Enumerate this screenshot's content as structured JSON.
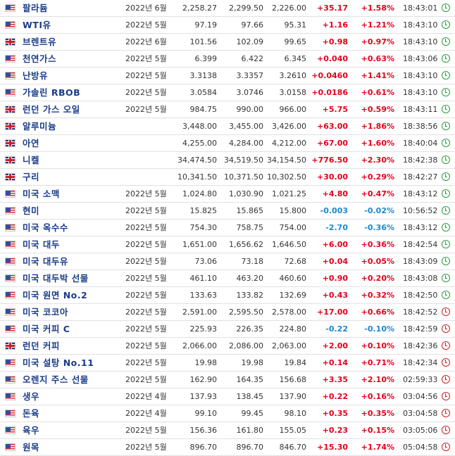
{
  "colors": {
    "up": "#e3001b",
    "down": "#1a87d2",
    "name": "#1a3c8a",
    "open_clock": "#22a036",
    "closed_clock": "#d21c1c"
  },
  "rows": [
    {
      "flag": "us",
      "name": "팔라듐",
      "month": "2022년 6월",
      "last": "2,258.27",
      "high": "2,299.50",
      "low": "2,226.00",
      "chg": "+35.17",
      "pct": "+1.58%",
      "time": "18:43:01",
      "dir": "up",
      "status": "open"
    },
    {
      "flag": "us",
      "name": "WTI유",
      "month": "2022년 5월",
      "last": "97.19",
      "high": "97.66",
      "low": "95.31",
      "chg": "+1.16",
      "pct": "+1.21%",
      "time": "18:43:10",
      "dir": "up",
      "status": "open"
    },
    {
      "flag": "uk",
      "name": "브렌트유",
      "month": "2022년 6월",
      "last": "101.56",
      "high": "102.09",
      "low": "99.65",
      "chg": "+0.98",
      "pct": "+0.97%",
      "time": "18:43:10",
      "dir": "up",
      "status": "open"
    },
    {
      "flag": "us",
      "name": "천연가스",
      "month": "2022년 5월",
      "last": "6.399",
      "high": "6.422",
      "low": "6.345",
      "chg": "+0.040",
      "pct": "+0.63%",
      "time": "18:43:06",
      "dir": "up",
      "status": "open"
    },
    {
      "flag": "us",
      "name": "난방유",
      "month": "2022년 5월",
      "last": "3.3138",
      "high": "3.3357",
      "low": "3.2610",
      "chg": "+0.0460",
      "pct": "+1.41%",
      "time": "18:43:10",
      "dir": "up",
      "status": "open"
    },
    {
      "flag": "us",
      "name": "가솔린 RBOB",
      "month": "2022년 5월",
      "last": "3.0584",
      "high": "3.0746",
      "low": "3.0158",
      "chg": "+0.0186",
      "pct": "+0.61%",
      "time": "18:43:10",
      "dir": "up",
      "status": "open"
    },
    {
      "flag": "uk",
      "name": "런던 가스 오일",
      "month": "2022년 5월",
      "last": "984.75",
      "high": "990.00",
      "low": "966.00",
      "chg": "+5.75",
      "pct": "+0.59%",
      "time": "18:43:11",
      "dir": "up",
      "status": "open"
    },
    {
      "flag": "uk",
      "name": "알루미늄",
      "month": "",
      "last": "3,448.00",
      "high": "3,455.00",
      "low": "3,426.00",
      "chg": "+63.00",
      "pct": "+1.86%",
      "time": "18:38:56",
      "dir": "up",
      "status": "open"
    },
    {
      "flag": "uk",
      "name": "아연",
      "month": "",
      "last": "4,255.00",
      "high": "4,284.00",
      "low": "4,212.00",
      "chg": "+67.00",
      "pct": "+1.60%",
      "time": "18:40:04",
      "dir": "up",
      "status": "open"
    },
    {
      "flag": "uk",
      "name": "니켈",
      "month": "",
      "last": "34,474.50",
      "high": "34,519.50",
      "low": "34,154.50",
      "chg": "+776.50",
      "pct": "+2.30%",
      "time": "18:42:38",
      "dir": "up",
      "status": "open"
    },
    {
      "flag": "uk",
      "name": "구리",
      "month": "",
      "last": "10,341.50",
      "high": "10,371.50",
      "low": "10,302.50",
      "chg": "+30.00",
      "pct": "+0.29%",
      "time": "18:42:27",
      "dir": "up",
      "status": "open"
    },
    {
      "flag": "us",
      "name": "미국 소맥",
      "month": "2022년 5월",
      "last": "1,024.80",
      "high": "1,030.90",
      "low": "1,021.25",
      "chg": "+4.80",
      "pct": "+0.47%",
      "time": "18:43:12",
      "dir": "up",
      "status": "open"
    },
    {
      "flag": "us",
      "name": "현미",
      "month": "2022년 5월",
      "last": "15.825",
      "high": "15.865",
      "low": "15.800",
      "chg": "-0.003",
      "pct": "-0.02%",
      "time": "10:56:52",
      "dir": "down",
      "status": "open"
    },
    {
      "flag": "us",
      "name": "미국 옥수수",
      "month": "2022년 5월",
      "last": "754.30",
      "high": "758.75",
      "low": "754.00",
      "chg": "-2.70",
      "pct": "-0.36%",
      "time": "18:43:12",
      "dir": "down",
      "status": "open"
    },
    {
      "flag": "us",
      "name": "미국 대두",
      "month": "2022년 5월",
      "last": "1,651.00",
      "high": "1,656.62",
      "low": "1,646.50",
      "chg": "+6.00",
      "pct": "+0.36%",
      "time": "18:42:54",
      "dir": "up",
      "status": "open"
    },
    {
      "flag": "us",
      "name": "미국 대두유",
      "month": "2022년 5월",
      "last": "73.06",
      "high": "73.18",
      "low": "72.68",
      "chg": "+0.04",
      "pct": "+0.05%",
      "time": "18:43:09",
      "dir": "up",
      "status": "open"
    },
    {
      "flag": "us",
      "name": "미국 대두박 선물",
      "month": "2022년 5월",
      "last": "461.10",
      "high": "463.20",
      "low": "460.60",
      "chg": "+0.90",
      "pct": "+0.20%",
      "time": "18:43:08",
      "dir": "up",
      "status": "open"
    },
    {
      "flag": "us",
      "name": "미국 원면 No.2",
      "month": "2022년 5월",
      "last": "133.63",
      "high": "133.82",
      "low": "132.69",
      "chg": "+0.43",
      "pct": "+0.32%",
      "time": "18:42:50",
      "dir": "up",
      "status": "open"
    },
    {
      "flag": "us",
      "name": "미국 코코아",
      "month": "2022년 5월",
      "last": "2,591.00",
      "high": "2,595.50",
      "low": "2,578.00",
      "chg": "+17.00",
      "pct": "+0.66%",
      "time": "18:42:52",
      "dir": "up",
      "status": "closed"
    },
    {
      "flag": "us",
      "name": "미국 커피 C",
      "month": "2022년 5월",
      "last": "225.93",
      "high": "226.35",
      "low": "224.80",
      "chg": "-0.22",
      "pct": "-0.10%",
      "time": "18:42:59",
      "dir": "down",
      "status": "closed"
    },
    {
      "flag": "uk",
      "name": "런던 커피",
      "month": "2022년 5월",
      "last": "2,066.00",
      "high": "2,086.00",
      "low": "2,063.00",
      "chg": "+2.00",
      "pct": "+0.10%",
      "time": "18:42:36",
      "dir": "up",
      "status": "closed"
    },
    {
      "flag": "us",
      "name": "미국 설탕 No.11",
      "month": "2022년 5월",
      "last": "19.98",
      "high": "19.98",
      "low": "19.84",
      "chg": "+0.14",
      "pct": "+0.71%",
      "time": "18:42:34",
      "dir": "up",
      "status": "closed"
    },
    {
      "flag": "us",
      "name": "오렌지 주스 선물",
      "month": "2022년 5월",
      "last": "162.90",
      "high": "164.35",
      "low": "156.68",
      "chg": "+3.35",
      "pct": "+2.10%",
      "time": "02:59:33",
      "dir": "up",
      "status": "closed"
    },
    {
      "flag": "us",
      "name": "생우",
      "month": "2022년 4월",
      "last": "137.93",
      "high": "138.45",
      "low": "137.90",
      "chg": "+0.22",
      "pct": "+0.16%",
      "time": "03:04:56",
      "dir": "up",
      "status": "closed"
    },
    {
      "flag": "us",
      "name": "돈육",
      "month": "2022년 4월",
      "last": "99.10",
      "high": "99.45",
      "low": "98.10",
      "chg": "+0.35",
      "pct": "+0.35%",
      "time": "03:04:58",
      "dir": "up",
      "status": "closed"
    },
    {
      "flag": "us",
      "name": "육우",
      "month": "2022년 5월",
      "last": "156.36",
      "high": "161.80",
      "low": "155.05",
      "chg": "+0.23",
      "pct": "+0.15%",
      "time": "03:05:06",
      "dir": "up",
      "status": "closed"
    },
    {
      "flag": "us",
      "name": "원목",
      "month": "2022년 5월",
      "last": "896.70",
      "high": "896.70",
      "low": "846.70",
      "chg": "+15.30",
      "pct": "+1.74%",
      "time": "05:04:58",
      "dir": "up",
      "status": "closed"
    }
  ]
}
